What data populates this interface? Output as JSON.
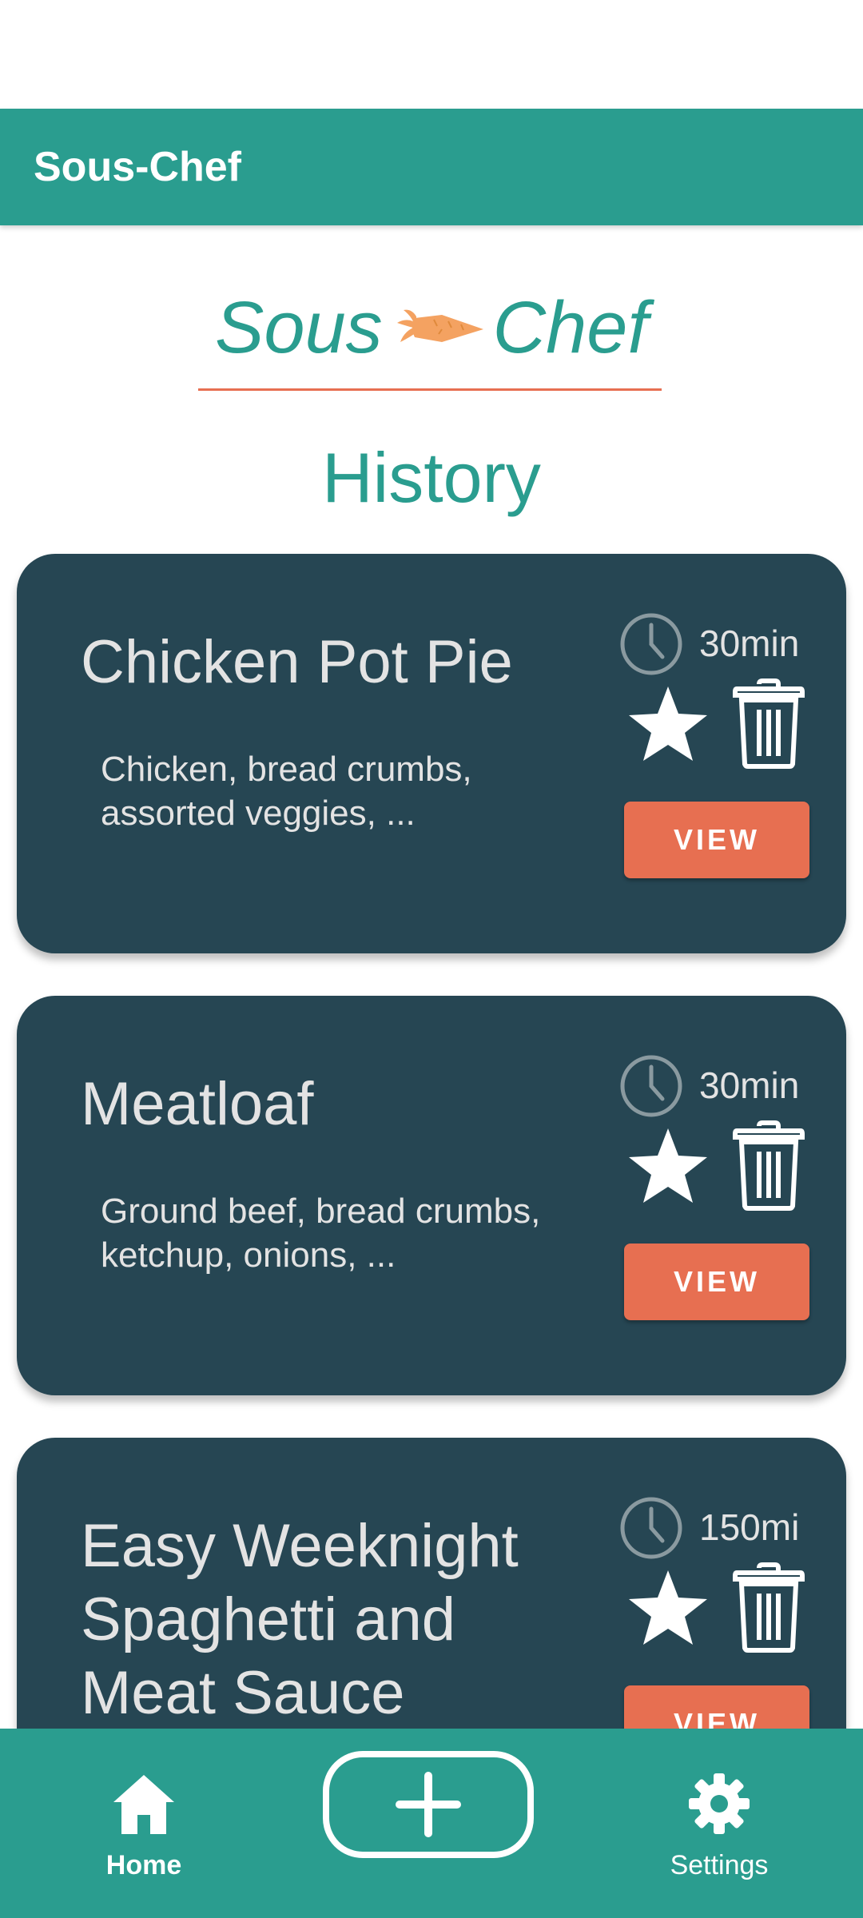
{
  "app_bar": {
    "title": "Sous-Chef"
  },
  "logo": {
    "left_word": "Sous",
    "right_word": "Chef",
    "icon": "carrot-icon"
  },
  "page": {
    "heading": "History"
  },
  "recipes": [
    {
      "title": "Chicken Pot Pie",
      "description": "Chicken, bread crumbs, assorted veggies, ...",
      "time": "30min",
      "view_label": "VIEW"
    },
    {
      "title": "Meatloaf",
      "description": "Ground beef, bread crumbs, ketchup, onions, ...",
      "time": "30min",
      "view_label": "VIEW"
    },
    {
      "title": "Easy Weeknight Spaghetti and Meat Sauce",
      "description": "",
      "time": "150mi",
      "view_label": "VIEW"
    }
  ],
  "bottom_nav": {
    "home_label": "Home",
    "settings_label": "Settings",
    "icons": {
      "home": "home-icon",
      "add": "plus-icon",
      "settings": "gear-icon"
    }
  },
  "colors": {
    "teal": "#2a9d8f",
    "card": "#264653",
    "accent": "#e76f51",
    "carrot": "#f4a261",
    "text_light": "#e3e3e3"
  }
}
